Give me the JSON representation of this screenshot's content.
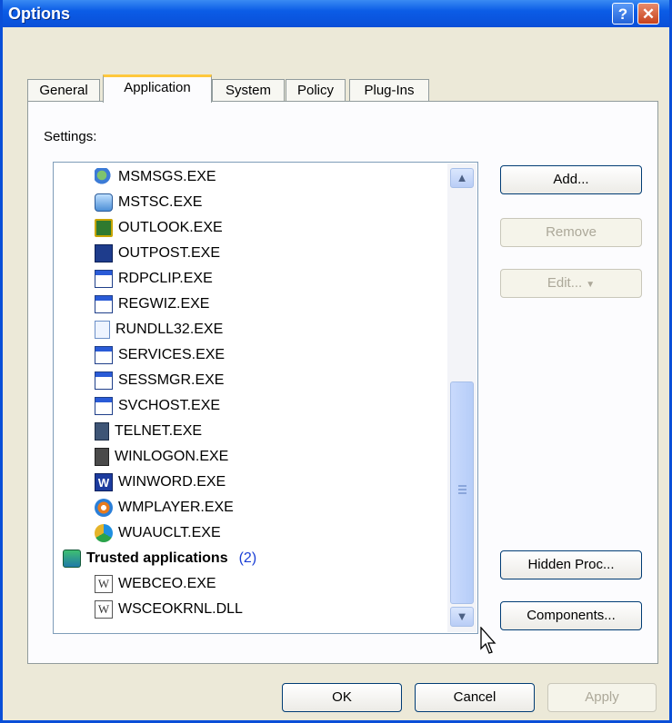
{
  "window": {
    "title": "Options",
    "help_glyph": "?",
    "close_glyph": "✕",
    "frame_color": "#0a4fd8"
  },
  "tabs": [
    {
      "label": "General",
      "active": false
    },
    {
      "label": "Application",
      "active": true
    },
    {
      "label": "System",
      "active": false
    },
    {
      "label": "Policy",
      "active": false
    },
    {
      "label": "Plug-Ins",
      "active": false
    }
  ],
  "settings_label": "Settings:",
  "list": {
    "items": [
      {
        "label": "MSMSGS.EXE",
        "icon": "msn-messenger-icon"
      },
      {
        "label": "MSTSC.EXE",
        "icon": "remote-desktop-icon"
      },
      {
        "label": "OUTLOOK.EXE",
        "icon": "outlook-icon"
      },
      {
        "label": "OUTPOST.EXE",
        "icon": "outpost-icon"
      },
      {
        "label": "RDPCLIP.EXE",
        "icon": "application-window-icon"
      },
      {
        "label": "REGWIZ.EXE",
        "icon": "application-window-icon"
      },
      {
        "label": "RUNDLL32.EXE",
        "icon": "document-icon"
      },
      {
        "label": "SERVICES.EXE",
        "icon": "application-window-icon"
      },
      {
        "label": "SESSMGR.EXE",
        "icon": "application-window-icon"
      },
      {
        "label": "SVCHOST.EXE",
        "icon": "application-window-icon"
      },
      {
        "label": "TELNET.EXE",
        "icon": "telnet-icon"
      },
      {
        "label": "WINLOGON.EXE",
        "icon": "winlogon-icon"
      },
      {
        "label": "WINWORD.EXE",
        "icon": "word-icon"
      },
      {
        "label": "WMPLAYER.EXE",
        "icon": "media-player-icon"
      },
      {
        "label": "WUAUCLT.EXE",
        "icon": "windows-update-icon"
      }
    ],
    "group": {
      "label": "Trusted applications",
      "count": "(2)",
      "icon": "trusted-group-icon"
    },
    "group_items": [
      {
        "label": "WEBCEO.EXE",
        "icon": "w-file-icon",
        "glyph": "W"
      },
      {
        "label": "WSCEOKRNL.DLL",
        "icon": "w-file-icon",
        "glyph": "W"
      }
    ],
    "scroll_up_glyph": "▲",
    "scroll_down_glyph": "▼"
  },
  "side_buttons": {
    "add": "Add...",
    "remove": "Remove",
    "edit": "Edit...",
    "edit_caret": "▼",
    "hidden_proc": "Hidden Proc...",
    "components": "Components..."
  },
  "footer_buttons": {
    "ok": "OK",
    "cancel": "Cancel",
    "apply": "Apply"
  }
}
